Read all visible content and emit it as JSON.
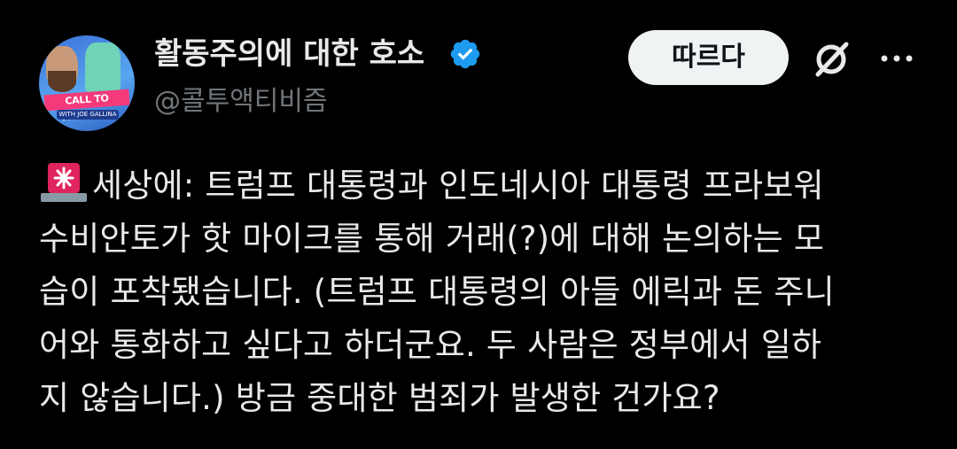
{
  "header": {
    "display_name": "활동주의에 대한 호소",
    "handle": "@콜투액티비즘",
    "follow_label": "따르다",
    "avatar": {
      "banner_text": "CALL TO ACTIVISM",
      "sub_text": "WITH JOE GALLINA"
    },
    "icons": {
      "verified": "verified-badge-icon",
      "grok": "grok-icon",
      "more": "more-options-icon"
    }
  },
  "tweet": {
    "lead_emoji": "siren-icon",
    "lines": [
      "세상에: 트럼프 대통령과 인도네시아 대통령 프라보워",
      "수비안토가 핫 마이크를 통해 거래(?)에 대해 논의하는 모",
      "습이 포착됐습니다. (트럼프 대통령의 아들 에릭과 돈 주니",
      "어와 통화하고 싶다고 하더군요. 두 사람은 정부에서 일하",
      "지 않습니다.) 방금 중대한 범죄가 발생한 건가요?"
    ]
  },
  "colors": {
    "background": "#000000",
    "text_primary": "#e7e9ea",
    "text_secondary": "#71767b",
    "verified_blue": "#1d9bf0",
    "button_bg": "#eff3f4",
    "siren_red": "#e0245e"
  }
}
